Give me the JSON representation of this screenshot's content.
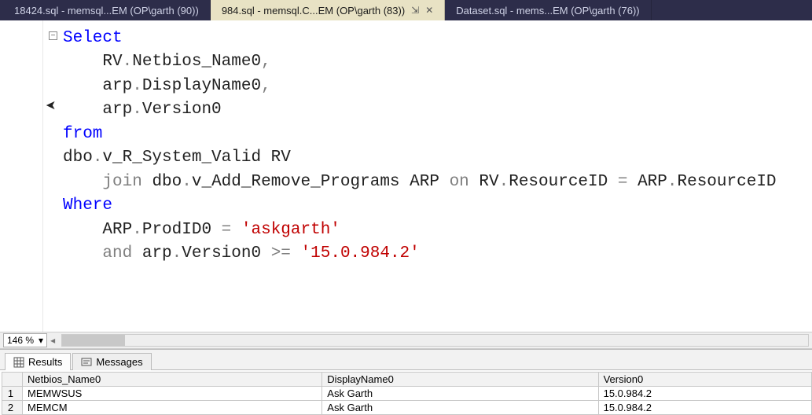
{
  "tabs": [
    {
      "label": "18424.sql - memsql...EM (OP\\garth (90))",
      "active": false
    },
    {
      "label": "984.sql - memsql.C...EM (OP\\garth (83))",
      "active": true
    },
    {
      "label": "Dataset.sql - mems...EM (OP\\garth (76))",
      "active": false
    }
  ],
  "collapse_glyph": "−",
  "sql": {
    "select_kw": "Select",
    "col1_pfx": "RV",
    "col1_name": "Netbios_Name0",
    "col2_pfx": "arp",
    "col2_name": "DisplayName0",
    "col3_pfx": "arp",
    "col3_name": "Version0",
    "from_kw": "from",
    "tbl1_schema": "dbo",
    "tbl1_name": "v_R_System_Valid",
    "tbl1_alias": "RV",
    "join_kw": "join",
    "on_kw": "on",
    "tbl2_schema": "dbo",
    "tbl2_name": "v_Add_Remove_Programs",
    "tbl2_alias": "ARP",
    "join_left_pfx": "RV",
    "join_left_col": "ResourceID",
    "join_right_pfx": "ARP",
    "join_right_col": "ResourceID",
    "where_kw": "Where",
    "w1_pfx": "ARP",
    "w1_col": "ProdID0",
    "w1_val": "'askgarth'",
    "and_kw": "and",
    "w2_pfx": "arp",
    "w2_col": "Version0",
    "w2_op": ">=",
    "w2_val": "'15.0.984.2'",
    "comma": ",",
    "dot": ".",
    "eq": "="
  },
  "zoom": {
    "value": "146 %",
    "chevron": "▾",
    "scroll_left": "◂"
  },
  "result_tabs": {
    "results": "Results",
    "messages": "Messages"
  },
  "grid": {
    "rowcorner": "",
    "headers": [
      "Netbios_Name0",
      "DisplayName0",
      "Version0"
    ],
    "rows": [
      {
        "n": "1",
        "cells": [
          "MEMWSUS",
          "Ask Garth",
          "15.0.984.2"
        ]
      },
      {
        "n": "2",
        "cells": [
          "MEMCM",
          "Ask Garth",
          "15.0.984.2"
        ]
      }
    ]
  },
  "chart_data": {
    "type": "table",
    "title": "Query results",
    "headers": [
      "Netbios_Name0",
      "DisplayName0",
      "Version0"
    ],
    "rows": [
      [
        "MEMWSUS",
        "Ask Garth",
        "15.0.984.2"
      ],
      [
        "MEMCM",
        "Ask Garth",
        "15.0.984.2"
      ]
    ]
  }
}
